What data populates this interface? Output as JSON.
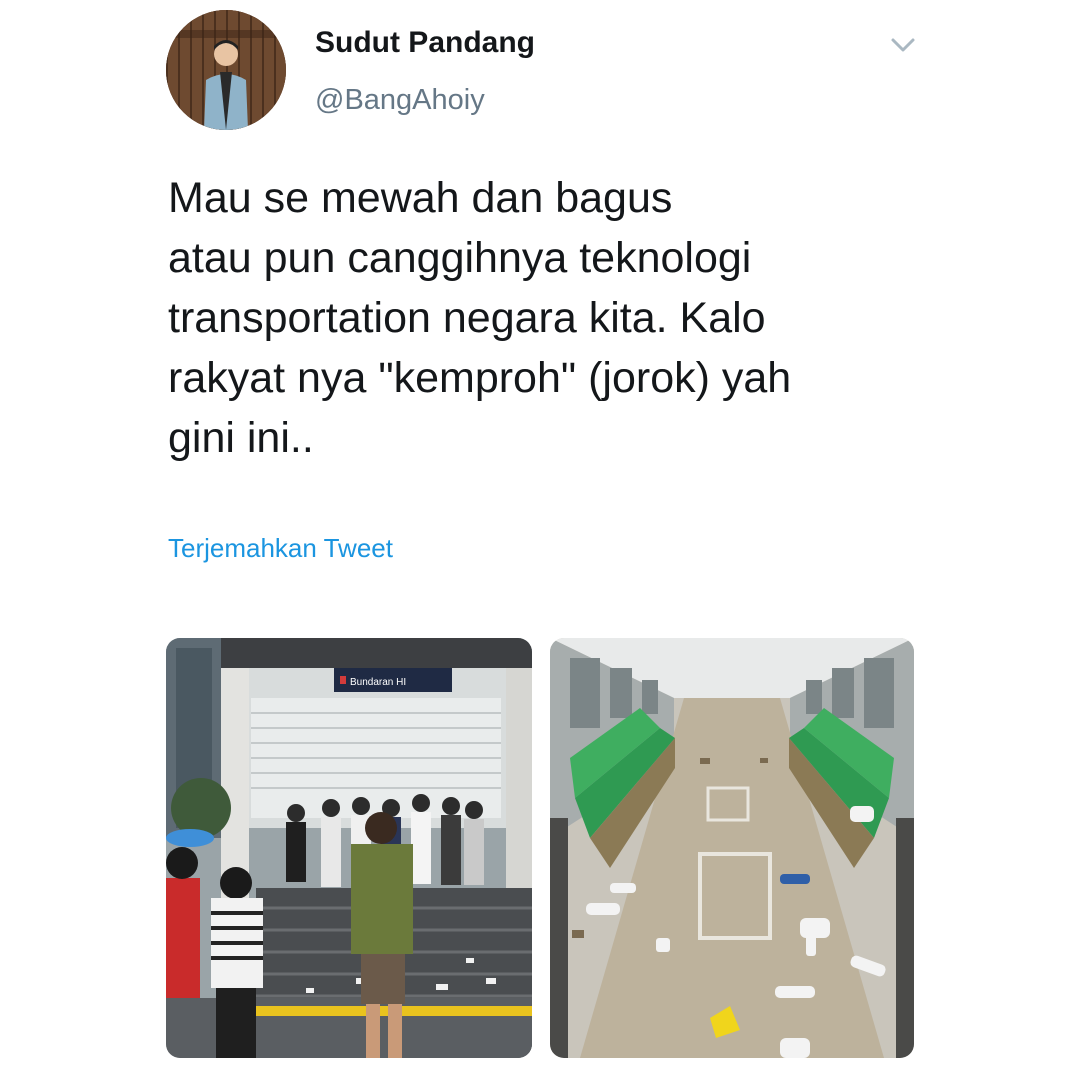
{
  "tweet": {
    "display_name": "Sudut Pandang",
    "handle": "@BangAhoiy",
    "text": "Mau se mewah dan bagus\natau pun canggihnya teknologi\ntransportation negara kita. Kalo\nrakyat nya \"kemproh\" (jorok) yah\ngini ini..",
    "translate_label": "Terjemahkan Tweet",
    "menu_icon": "chevron-down-icon"
  },
  "media": {
    "left_photo": {
      "station_sign": "Bundaran HI"
    },
    "right_photo": {}
  },
  "colors": {
    "text": "#14171a",
    "secondary": "#657786",
    "link": "#1b95e0"
  }
}
